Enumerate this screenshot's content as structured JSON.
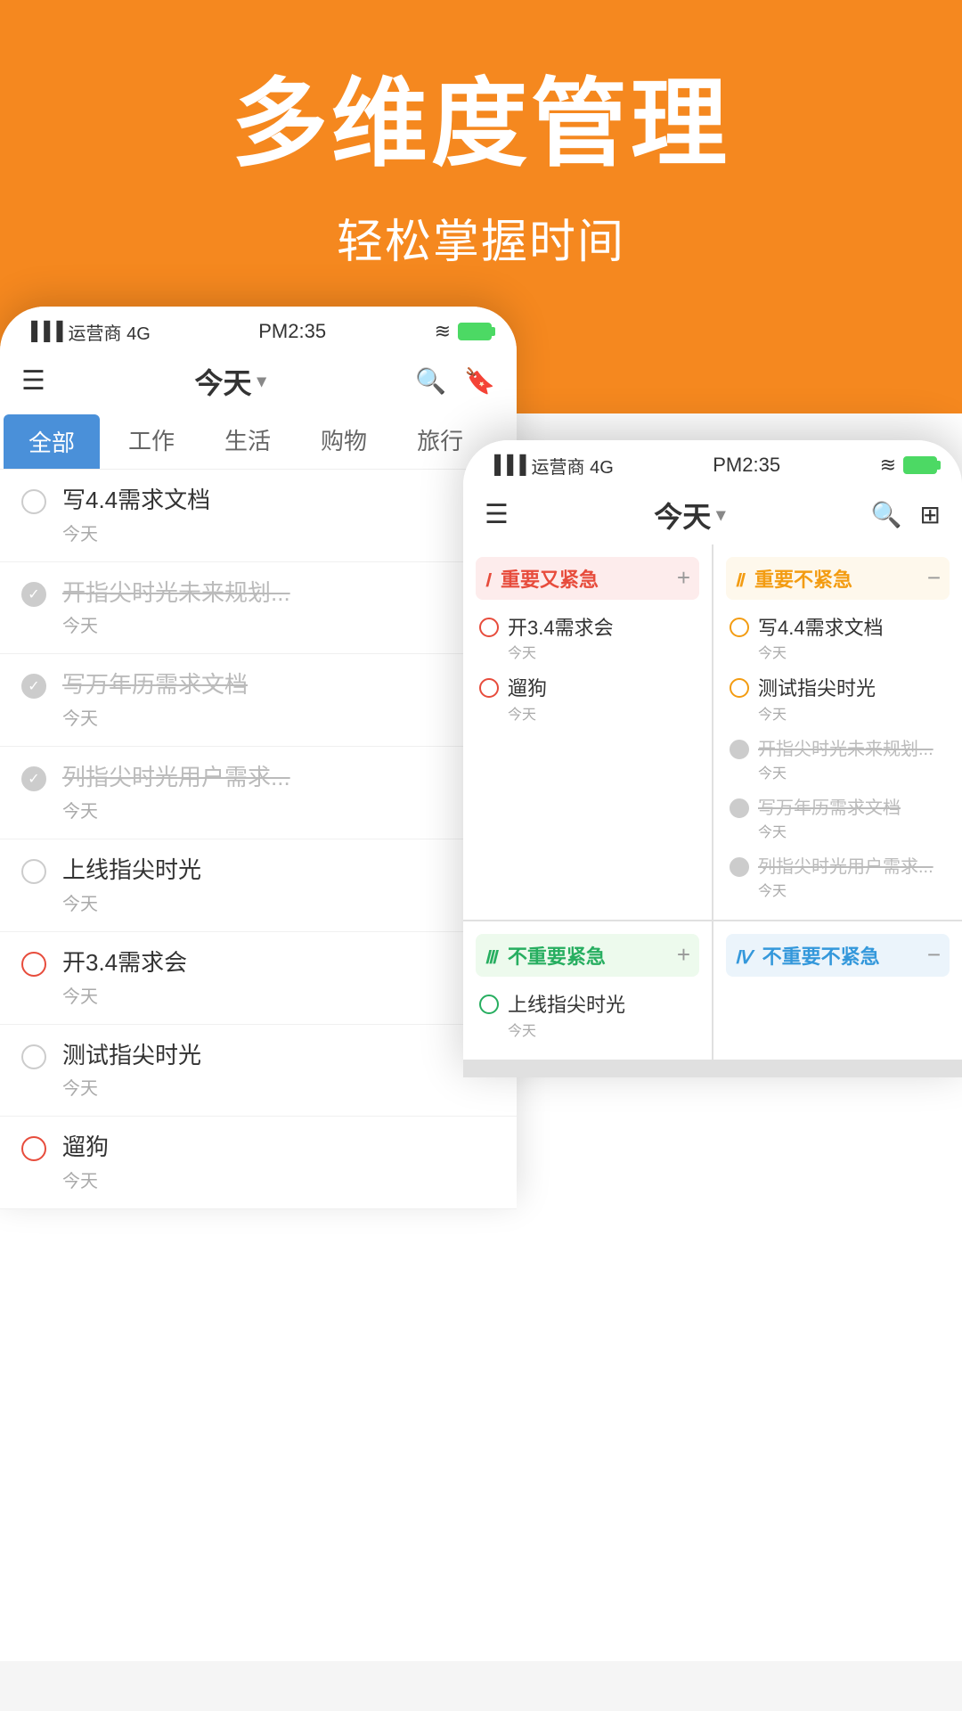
{
  "hero": {
    "title": "多维度管理",
    "subtitle": "轻松掌握时间"
  },
  "phone_back": {
    "status": {
      "carrier": "运营商 4G",
      "time": "PM2:35"
    },
    "nav": {
      "title": "今天",
      "dropdown": "▾"
    },
    "tabs": [
      "全部",
      "工作",
      "生活",
      "购物",
      "旅行"
    ],
    "tasks": [
      {
        "name": "写4.4需求文档",
        "date": "今天",
        "status": "normal"
      },
      {
        "name": "开指尖时光未来规划...",
        "date": "今天",
        "status": "checked"
      },
      {
        "name": "写万年历需求文档",
        "date": "今天",
        "status": "checked"
      },
      {
        "name": "列指尖时光用户需求...",
        "date": "今天",
        "status": "checked"
      },
      {
        "name": "上线指尖时光",
        "date": "今天",
        "status": "normal"
      },
      {
        "name": "开3.4需求会",
        "date": "今天",
        "status": "urgent"
      },
      {
        "name": "测试指尖时光",
        "date": "今天",
        "status": "normal"
      },
      {
        "name": "遛狗",
        "date": "今天",
        "status": "urgent"
      }
    ]
  },
  "phone_front": {
    "status": {
      "carrier": "运营商 4G",
      "time": "PM2:35"
    },
    "nav": {
      "title": "今天",
      "dropdown": "▾"
    },
    "quadrants": [
      {
        "id": "q1",
        "roman": "Ⅰ",
        "label": "重要又紧急",
        "color_class": "q1",
        "tasks": [
          {
            "name": "开3.4需求会",
            "date": "今天",
            "status": "urgent"
          },
          {
            "name": "遛狗",
            "date": "今天",
            "status": "urgent"
          }
        ]
      },
      {
        "id": "q2",
        "roman": "Ⅱ",
        "label": "重要不紧急",
        "color_class": "q2",
        "tasks": [
          {
            "name": "写4.4需求文档",
            "date": "今天",
            "status": "normal"
          },
          {
            "name": "测试指尖时光",
            "date": "今天",
            "status": "normal"
          },
          {
            "name": "开指尖时光未来规划...",
            "date": "今天",
            "status": "checked"
          },
          {
            "name": "写万年历需求文档",
            "date": "今天",
            "status": "checked"
          },
          {
            "name": "列指尖时光用户需求...",
            "date": "今天",
            "status": "checked"
          }
        ]
      },
      {
        "id": "q3",
        "roman": "Ⅲ",
        "label": "不重要紧急",
        "color_class": "q3",
        "tasks": [
          {
            "name": "上线指尖时光",
            "date": "今天",
            "status": "normal"
          }
        ]
      },
      {
        "id": "q4",
        "roman": "Ⅳ",
        "label": "不重要不紧急",
        "color_class": "q4",
        "tasks": []
      }
    ]
  }
}
